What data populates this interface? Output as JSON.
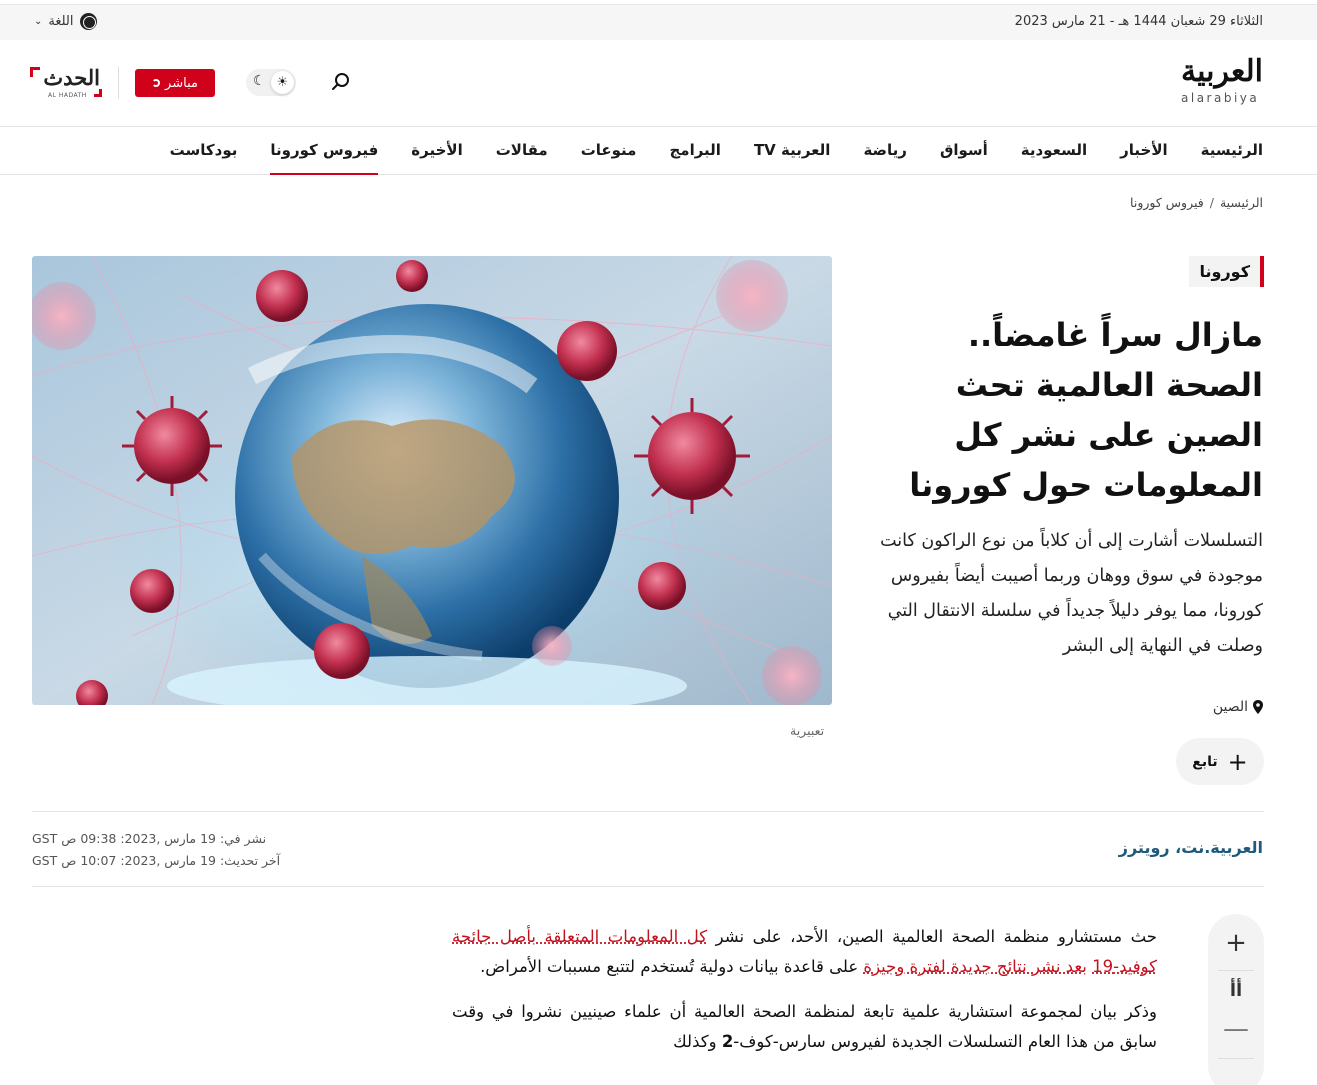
{
  "topbar": {
    "date": "الثلاثاء 29 شعبان 1444 هـ - 21 مارس 2023",
    "language_label": "اللغة"
  },
  "header": {
    "logo_ar": "العربية",
    "logo_en": "alarabiya",
    "live_label": "مباشر",
    "alhadath_ar": "الحدث",
    "alhadath_en": "AL HADATH"
  },
  "nav": {
    "items": [
      {
        "label": "الرئيسية"
      },
      {
        "label": "الأخبار"
      },
      {
        "label": "السعودية"
      },
      {
        "label": "أسواق"
      },
      {
        "label": "رياضة"
      },
      {
        "label": "العربية TV"
      },
      {
        "label": "البرامج"
      },
      {
        "label": "منوعات"
      },
      {
        "label": "مقالات"
      },
      {
        "label": "الأخيرة"
      },
      {
        "label": "فيروس كورونا",
        "active": true
      },
      {
        "label": "بودكاست"
      }
    ]
  },
  "breadcrumb": {
    "home": "الرئيسية",
    "separator": "/",
    "section": "فيروس كورونا"
  },
  "article": {
    "tag": "كورونا",
    "headline": "مازال سراً غامضاً.. الصحة العالمية تحث الصين على نشر كل المعلومات حول كورونا",
    "lead": "التسلسلات أشارت إلى أن كلاباً من نوع الراكون كانت موجودة في سوق ووهان وربما أصيبت أيضاً بفيروس كورونا، مما يوفر دليلاً جديداً في سلسلة الانتقال التي وصلت في النهاية إلى البشر",
    "location": "الصين",
    "follow_label": "تابع",
    "image_caption": "تعبيرية",
    "source": "العربية.نت، رويترز",
    "published": "نشر في: 19 مارس ,2023: 09:38 ص GST",
    "updated": "آخر تحديث: 19 مارس ,2023: 10:07 ص GST",
    "p1_a": "حث مستشارو منظمة الصحة العالمية الصين، الأحد، على نشر ",
    "p1_link1": "كل المعلومات المتعلقة بأصل جائحة كوفيد-19",
    "p1_b": " ",
    "p1_link2": "بعد نشر نتائج جديدة لفترة وجيزة",
    "p1_c": " على قاعدة بيانات دولية تُستخدم لتتبع مسببات الأمراض.",
    "p2_a": "وذكر بيان لمجموعة استشارية علمية تابعة لمنظمة الصحة العالمية أن علماء صينيين نشروا في وقت سابق من هذا العام التسلسلات الجديدة لفيروس سارس-كوف-",
    "p2_bold": "2",
    "p2_b": " وكذلك"
  },
  "tools": {
    "increase": "+",
    "font": "أأ",
    "decrease": "—"
  },
  "colors": {
    "brand_red": "#d0021b",
    "source_blue": "#1f5a7a"
  }
}
